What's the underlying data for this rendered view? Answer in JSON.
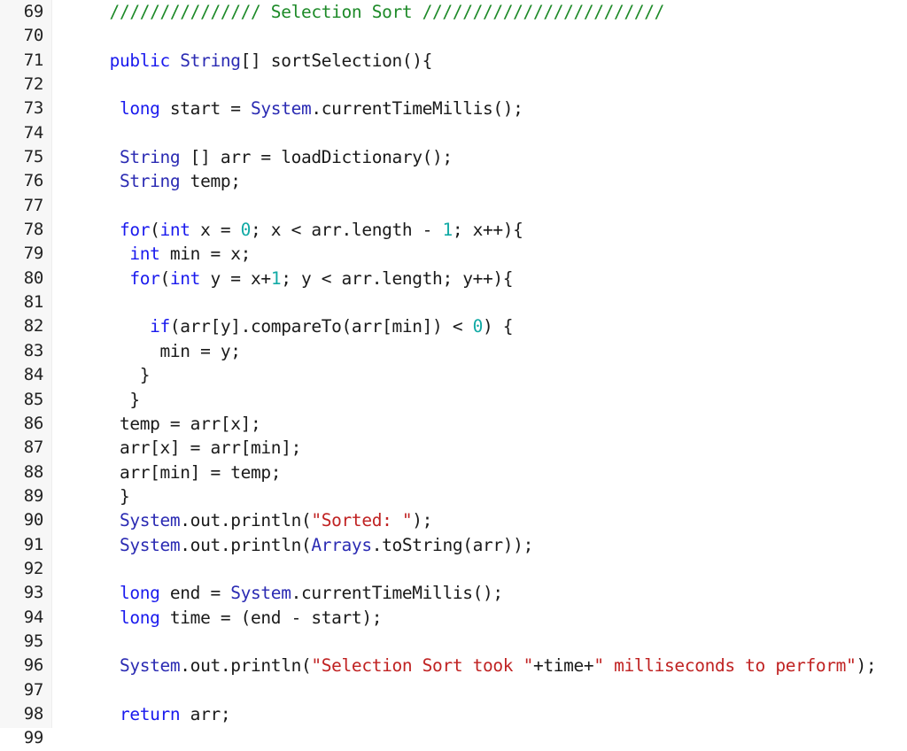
{
  "editor": {
    "language": "java",
    "first_line_number": 69,
    "last_line_number": 99,
    "gutter_bg": "#f7f7f7",
    "code_bg": "#ffffff",
    "colors": {
      "keyword": "#1a1aee",
      "type": "#2b2bb3",
      "class": "#2b2bb3",
      "comment": "#1d8a28",
      "string": "#c02222",
      "number": "#11aaa5",
      "plain": "#1a1a1a",
      "line_number": "#222222"
    }
  },
  "line_numbers": [
    "69",
    "70",
    "71",
    "72",
    "73",
    "74",
    "75",
    "76",
    "77",
    "78",
    "79",
    "80",
    "81",
    "82",
    "83",
    "84",
    "85",
    "86",
    "87",
    "88",
    "89",
    "90",
    "91",
    "92",
    "93",
    "94",
    "95",
    "96",
    "97",
    "98",
    "99"
  ],
  "lines": [
    {
      "n": "69",
      "tokens": [
        {
          "t": "comment",
          "s": "    /////////////// Selection Sort ////////////////////////"
        }
      ]
    },
    {
      "n": "70",
      "tokens": [
        {
          "t": "plain",
          "s": ""
        }
      ]
    },
    {
      "n": "71",
      "tokens": [
        {
          "t": "plain",
          "s": "    "
        },
        {
          "t": "keyword",
          "s": "public"
        },
        {
          "t": "plain",
          "s": " "
        },
        {
          "t": "type",
          "s": "String"
        },
        {
          "t": "plain",
          "s": "[] sortSelection(){"
        }
      ]
    },
    {
      "n": "72",
      "tokens": [
        {
          "t": "plain",
          "s": ""
        }
      ]
    },
    {
      "n": "73",
      "tokens": [
        {
          "t": "plain",
          "s": "     "
        },
        {
          "t": "keyword",
          "s": "long"
        },
        {
          "t": "plain",
          "s": " start = "
        },
        {
          "t": "class",
          "s": "System"
        },
        {
          "t": "plain",
          "s": ".currentTimeMillis();"
        }
      ]
    },
    {
      "n": "74",
      "tokens": [
        {
          "t": "plain",
          "s": ""
        }
      ]
    },
    {
      "n": "75",
      "tokens": [
        {
          "t": "plain",
          "s": "     "
        },
        {
          "t": "type",
          "s": "String"
        },
        {
          "t": "plain",
          "s": " [] arr = loadDictionary();"
        }
      ]
    },
    {
      "n": "76",
      "tokens": [
        {
          "t": "plain",
          "s": "     "
        },
        {
          "t": "type",
          "s": "String"
        },
        {
          "t": "plain",
          "s": " temp;"
        }
      ]
    },
    {
      "n": "77",
      "tokens": [
        {
          "t": "plain",
          "s": ""
        }
      ]
    },
    {
      "n": "78",
      "tokens": [
        {
          "t": "plain",
          "s": "     "
        },
        {
          "t": "keyword",
          "s": "for"
        },
        {
          "t": "plain",
          "s": "("
        },
        {
          "t": "keyword",
          "s": "int"
        },
        {
          "t": "plain",
          "s": " x = "
        },
        {
          "t": "number",
          "s": "0"
        },
        {
          "t": "plain",
          "s": "; x < arr.length - "
        },
        {
          "t": "number",
          "s": "1"
        },
        {
          "t": "plain",
          "s": "; x++){"
        }
      ]
    },
    {
      "n": "79",
      "tokens": [
        {
          "t": "plain",
          "s": "      "
        },
        {
          "t": "keyword",
          "s": "int"
        },
        {
          "t": "plain",
          "s": " min = x;"
        }
      ]
    },
    {
      "n": "80",
      "tokens": [
        {
          "t": "plain",
          "s": "      "
        },
        {
          "t": "keyword",
          "s": "for"
        },
        {
          "t": "plain",
          "s": "("
        },
        {
          "t": "keyword",
          "s": "int"
        },
        {
          "t": "plain",
          "s": " y = x+"
        },
        {
          "t": "number",
          "s": "1"
        },
        {
          "t": "plain",
          "s": "; y < arr.length; y++){"
        }
      ]
    },
    {
      "n": "81",
      "tokens": [
        {
          "t": "plain",
          "s": ""
        }
      ]
    },
    {
      "n": "82",
      "tokens": [
        {
          "t": "plain",
          "s": "        "
        },
        {
          "t": "keyword",
          "s": "if"
        },
        {
          "t": "plain",
          "s": "(arr[y].compareTo(arr[min]) < "
        },
        {
          "t": "number",
          "s": "0"
        },
        {
          "t": "plain",
          "s": ") {"
        }
      ]
    },
    {
      "n": "83",
      "tokens": [
        {
          "t": "plain",
          "s": "         min = y;"
        }
      ]
    },
    {
      "n": "84",
      "tokens": [
        {
          "t": "plain",
          "s": "       }"
        }
      ]
    },
    {
      "n": "85",
      "tokens": [
        {
          "t": "plain",
          "s": "      }"
        }
      ]
    },
    {
      "n": "86",
      "tokens": [
        {
          "t": "plain",
          "s": "     temp = arr[x];"
        }
      ]
    },
    {
      "n": "87",
      "tokens": [
        {
          "t": "plain",
          "s": "     arr[x] = arr[min];"
        }
      ]
    },
    {
      "n": "88",
      "tokens": [
        {
          "t": "plain",
          "s": "     arr[min] = temp;"
        }
      ]
    },
    {
      "n": "89",
      "tokens": [
        {
          "t": "plain",
          "s": "     }"
        }
      ]
    },
    {
      "n": "90",
      "tokens": [
        {
          "t": "plain",
          "s": "     "
        },
        {
          "t": "class",
          "s": "System"
        },
        {
          "t": "plain",
          "s": ".out.println("
        },
        {
          "t": "string",
          "s": "\"Sorted: \""
        },
        {
          "t": "plain",
          "s": ");"
        }
      ]
    },
    {
      "n": "91",
      "tokens": [
        {
          "t": "plain",
          "s": "     "
        },
        {
          "t": "class",
          "s": "System"
        },
        {
          "t": "plain",
          "s": ".out.println("
        },
        {
          "t": "class",
          "s": "Arrays"
        },
        {
          "t": "plain",
          "s": ".toString(arr));"
        }
      ]
    },
    {
      "n": "92",
      "tokens": [
        {
          "t": "plain",
          "s": ""
        }
      ]
    },
    {
      "n": "93",
      "tokens": [
        {
          "t": "plain",
          "s": "     "
        },
        {
          "t": "keyword",
          "s": "long"
        },
        {
          "t": "plain",
          "s": " end = "
        },
        {
          "t": "class",
          "s": "System"
        },
        {
          "t": "plain",
          "s": ".currentTimeMillis();"
        }
      ]
    },
    {
      "n": "94",
      "tokens": [
        {
          "t": "plain",
          "s": "     "
        },
        {
          "t": "keyword",
          "s": "long"
        },
        {
          "t": "plain",
          "s": " time = (end - start);"
        }
      ]
    },
    {
      "n": "95",
      "tokens": [
        {
          "t": "plain",
          "s": ""
        }
      ]
    },
    {
      "n": "96",
      "tokens": [
        {
          "t": "plain",
          "s": "     "
        },
        {
          "t": "class",
          "s": "System"
        },
        {
          "t": "plain",
          "s": ".out.println("
        },
        {
          "t": "string",
          "s": "\"Selection Sort took \""
        },
        {
          "t": "plain",
          "s": "+time+"
        },
        {
          "t": "string",
          "s": "\" milliseconds to perform\""
        },
        {
          "t": "plain",
          "s": ");"
        }
      ]
    },
    {
      "n": "97",
      "tokens": [
        {
          "t": "plain",
          "s": ""
        }
      ]
    },
    {
      "n": "98",
      "tokens": [
        {
          "t": "plain",
          "s": "     "
        },
        {
          "t": "keyword",
          "s": "return"
        },
        {
          "t": "plain",
          "s": " arr;"
        }
      ]
    },
    {
      "n": "99",
      "tokens": [
        {
          "t": "plain",
          "s": "    }"
        }
      ]
    }
  ]
}
